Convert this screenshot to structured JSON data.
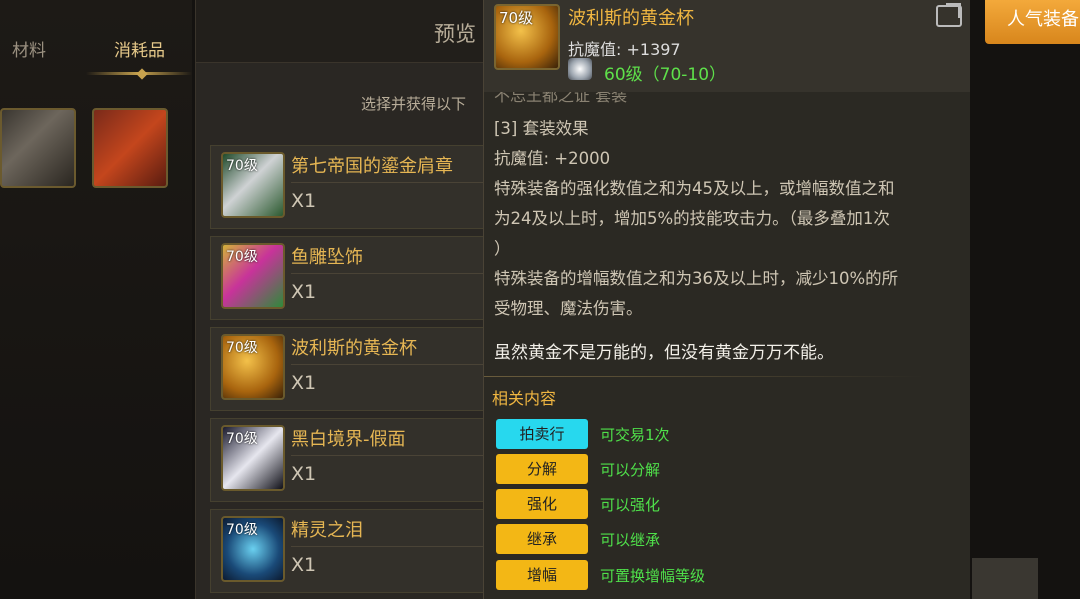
{
  "tabs": {
    "materials": "材料",
    "consumables": "消耗品"
  },
  "preview": {
    "title": "预览",
    "subtitle": "选择并获得以下",
    "items": [
      {
        "level": "70级",
        "name": "第七帝国的鎏金肩章",
        "qty": "X1"
      },
      {
        "level": "70级",
        "name": "鱼雕坠饰",
        "qty": "X1"
      },
      {
        "level": "70级",
        "name": "波利斯的黄金杯",
        "qty": "X1"
      },
      {
        "level": "70级",
        "name": "黑白境界-假面",
        "qty": "X1"
      },
      {
        "level": "70级",
        "name": "精灵之泪",
        "qty": "X1"
      }
    ]
  },
  "tooltip": {
    "level": "70级",
    "name": "波利斯的黄金杯",
    "stat": "抗魔值: +1397",
    "requirement": "60级（70-10）",
    "clipped": "不忘王都之证 套装",
    "set_label": "[3] 套装效果",
    "set_stat": "抗魔值: +2000",
    "effect1_line1": "特殊装备的强化数值之和为45及以上，或增幅数值之和",
    "effect1_line2": "为24及以上时，增加5%的技能攻击力。（最多叠加1次",
    "effect1_line3": "）",
    "effect2_line1": "特殊装备的增幅数值之和为36及以上时，减少10%的所",
    "effect2_line2": "受物理、魔法伤害。",
    "quote": "虽然黄金不是万能的，但没有黄金万万不能。",
    "related_title": "相关内容",
    "tags": [
      {
        "label": "拍卖行",
        "desc": "可交易1次"
      },
      {
        "label": "分解",
        "desc": "可以分解"
      },
      {
        "label": "强化",
        "desc": "可以强化"
      },
      {
        "label": "继承",
        "desc": "可以继承"
      },
      {
        "label": "增幅",
        "desc": "可置换增幅等级"
      }
    ]
  },
  "hot_button": "人气装备"
}
